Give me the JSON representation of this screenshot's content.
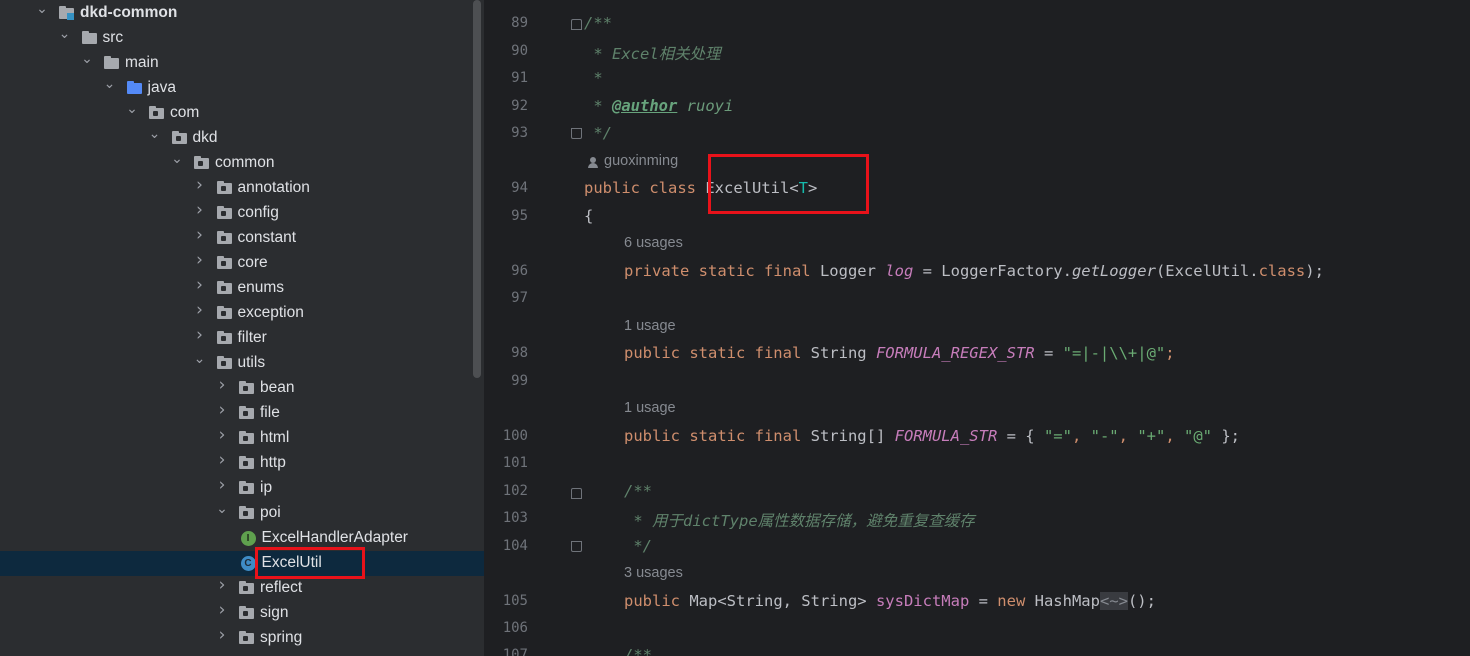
{
  "tree": {
    "rows": [
      {
        "label": "dkd-common",
        "icon": "module-folder-icon",
        "expanded": true
      },
      {
        "label": "src",
        "icon": "folder-icon",
        "expanded": true
      },
      {
        "label": "main",
        "icon": "folder-icon",
        "expanded": true
      },
      {
        "label": "java",
        "icon": "source-folder-icon",
        "expanded": true
      },
      {
        "label": "com",
        "icon": "package-icon",
        "expanded": true
      },
      {
        "label": "dkd",
        "icon": "package-icon",
        "expanded": true
      },
      {
        "label": "common",
        "icon": "package-icon",
        "expanded": true
      },
      {
        "label": "annotation",
        "icon": "package-icon",
        "expanded": false
      },
      {
        "label": "config",
        "icon": "package-icon",
        "expanded": false
      },
      {
        "label": "constant",
        "icon": "package-icon",
        "expanded": false
      },
      {
        "label": "core",
        "icon": "package-icon",
        "expanded": false
      },
      {
        "label": "enums",
        "icon": "package-icon",
        "expanded": false
      },
      {
        "label": "exception",
        "icon": "package-icon",
        "expanded": false
      },
      {
        "label": "filter",
        "icon": "package-icon",
        "expanded": false
      },
      {
        "label": "utils",
        "icon": "package-icon",
        "expanded": true
      },
      {
        "label": "bean",
        "icon": "package-icon",
        "expanded": false
      },
      {
        "label": "file",
        "icon": "package-icon",
        "expanded": false
      },
      {
        "label": "html",
        "icon": "package-icon",
        "expanded": false
      },
      {
        "label": "http",
        "icon": "package-icon",
        "expanded": false
      },
      {
        "label": "ip",
        "icon": "package-icon",
        "expanded": false
      },
      {
        "label": "poi",
        "icon": "package-icon",
        "expanded": true
      },
      {
        "label": "ExcelHandlerAdapter",
        "icon": "interface-icon",
        "badge": "I"
      },
      {
        "label": "ExcelUtil",
        "icon": "class-icon",
        "badge": "C",
        "selected": true
      },
      {
        "label": "reflect",
        "icon": "package-icon",
        "expanded": false
      },
      {
        "label": "sign",
        "icon": "package-icon",
        "expanded": false
      },
      {
        "label": "spring",
        "icon": "package-icon",
        "expanded": false
      }
    ]
  },
  "editor": {
    "line_numbers": [
      "89",
      "90",
      "91",
      "92",
      "93",
      "94",
      "95",
      "96",
      "97",
      "98",
      "99",
      "100",
      "101",
      "102",
      "103",
      "104",
      "105",
      "106",
      "107"
    ],
    "author_hint": "guoxinming",
    "usage_hints": [
      "6 usages",
      "1 usage",
      "1 usage",
      "3 usages"
    ],
    "code": {
      "l89": "/**",
      "l90_star": " * ",
      "l90_text": "Excel相关处理",
      "l91": " *",
      "l92_star": " * ",
      "l92_tag": "@author",
      "l92_val": " ruoyi",
      "l93": " */",
      "l94_kw": "public class ",
      "l94_name": "ExcelUtil<",
      "l94_tp": "T",
      "l94_end": ">",
      "l95": "{",
      "l96_kw": "private static final ",
      "l96_type": "Logger ",
      "l96_field": "log",
      "l96_mid": " = LoggerFactory.",
      "l96_method": "getLogger",
      "l96_arg": "(ExcelUtil.",
      "l96_cls": "class",
      "l96_end": ");",
      "l98_kw": "public static final ",
      "l98_type": "String ",
      "l98_field": "FORMULA_REGEX_STR",
      "l98_eq": " = ",
      "l98_str": "\"=|-|\\\\+|@\"",
      "l98_end": ";",
      "l100_kw": "public static final ",
      "l100_type": "String[] ",
      "l100_field": "FORMULA_STR",
      "l100_eq": " = { ",
      "l100_s1": "\"=\"",
      "l100_c1": ", ",
      "l100_s2": "\"-\"",
      "l100_c2": ", ",
      "l100_s3": "\"+\"",
      "l100_c3": ", ",
      "l100_s4": "\"@\"",
      "l100_end": " };",
      "l102": "/**",
      "l103_star": " * ",
      "l103_text": "用于",
      "l103_mono": "dictType",
      "l103_text2": "属性数据存储，避免重复查缓存",
      "l104": " */",
      "l105_kw": "public ",
      "l105_type": "Map<String, String> ",
      "l105_field": "sysDictMap",
      "l105_eq": " = ",
      "l105_new": "new ",
      "l105_cls": "HashMap",
      "l105_diamond": "<~>",
      "l105_end": "();",
      "l107": "/**"
    }
  },
  "colors": {
    "selection": "#0d293e",
    "highlight_box": "#e8121a",
    "keyword": "#cf8e6d",
    "string": "#6aab73",
    "field": "#c77dbb",
    "doc_comment": "#5f826b"
  }
}
